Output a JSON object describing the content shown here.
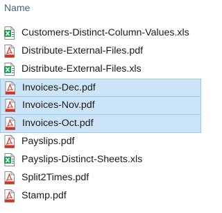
{
  "header": {
    "name_label": "Name"
  },
  "files": [
    {
      "name": "Customers-Distinct-Column-Values.xls",
      "type": "excel",
      "selected": false
    },
    {
      "name": "Distribute-External-Files.pdf",
      "type": "pdf",
      "selected": false
    },
    {
      "name": "Distribute-External-Files.xls",
      "type": "excel",
      "selected": false
    },
    {
      "name": "Invoices-Dec.pdf",
      "type": "pdf",
      "selected": true
    },
    {
      "name": "Invoices-Nov.pdf",
      "type": "pdf",
      "selected": true
    },
    {
      "name": "Invoices-Oct.pdf",
      "type": "pdf",
      "selected": true
    },
    {
      "name": "Payslips.pdf",
      "type": "pdf",
      "selected": false
    },
    {
      "name": "Payslips-Distinct-Sheets.xls",
      "type": "excel",
      "selected": false
    },
    {
      "name": "Split2Times.pdf",
      "type": "pdf",
      "selected": false
    },
    {
      "name": "Stamp.pdf",
      "type": "pdf",
      "selected": false
    }
  ],
  "colors": {
    "selection_bg": "#cce4f7",
    "selection_border": "#99c9ef",
    "excel_green": "#1f9d55",
    "pdf_red": "#d93025",
    "header_text": "#4c607a"
  }
}
